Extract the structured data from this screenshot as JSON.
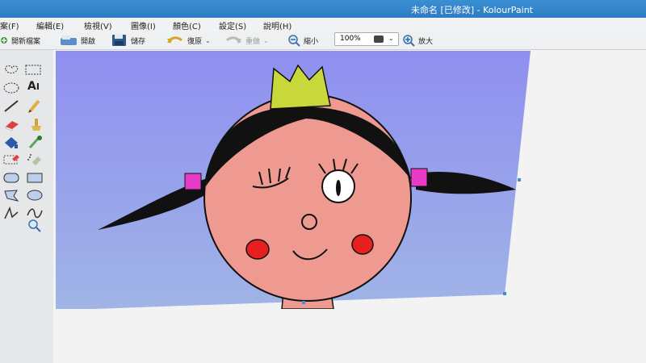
{
  "window": {
    "title": "未命名 [已修改] - KolourPaint"
  },
  "menu": [
    {
      "label": "案(F)"
    },
    {
      "label": "編輯(E)"
    },
    {
      "label": "檢視(V)"
    },
    {
      "label": "圖像(I)"
    },
    {
      "label": "顏色(C)"
    },
    {
      "label": "設定(S)"
    },
    {
      "label": "說明(H)"
    }
  ],
  "toolbar": {
    "new_label": "開新檔案",
    "open_label": "開啟",
    "save_label": "儲存",
    "undo_label": "復原",
    "redo_label": "重做",
    "zoom_out_label": "縮小",
    "zoom_value": "100%",
    "zoom_in_label": "放大"
  },
  "tools": [
    {
      "icon": "free-select-icon"
    },
    {
      "icon": "rect-select-icon"
    },
    {
      "icon": "ellipse-select-icon"
    },
    {
      "icon": "text-icon",
      "text": "A"
    },
    {
      "icon": "line-icon"
    },
    {
      "icon": "pen-icon"
    },
    {
      "icon": "eraser-icon"
    },
    {
      "icon": "brush-icon"
    },
    {
      "icon": "flood-fill-icon"
    },
    {
      "icon": "color-picker-icon"
    },
    {
      "icon": "color-eraser-icon"
    },
    {
      "icon": "spraycan-icon"
    },
    {
      "icon": "rounded-rect-icon"
    },
    {
      "icon": "rectangle-icon"
    },
    {
      "icon": "polygon-icon"
    },
    {
      "icon": "ellipse-icon"
    },
    {
      "icon": "polyline-icon"
    },
    {
      "icon": "curve-icon"
    },
    {
      "icon": "zoom-tool-icon"
    }
  ],
  "colors": {
    "canvas_bg_top": "#8f8ff0",
    "canvas_bg_bottom": "#a0b4e6",
    "skin": "#ef9a90",
    "hair": "#111111",
    "crown": "#c8d83a",
    "ribbon": "#e83cc8",
    "cheek": "#e81f1f"
  }
}
